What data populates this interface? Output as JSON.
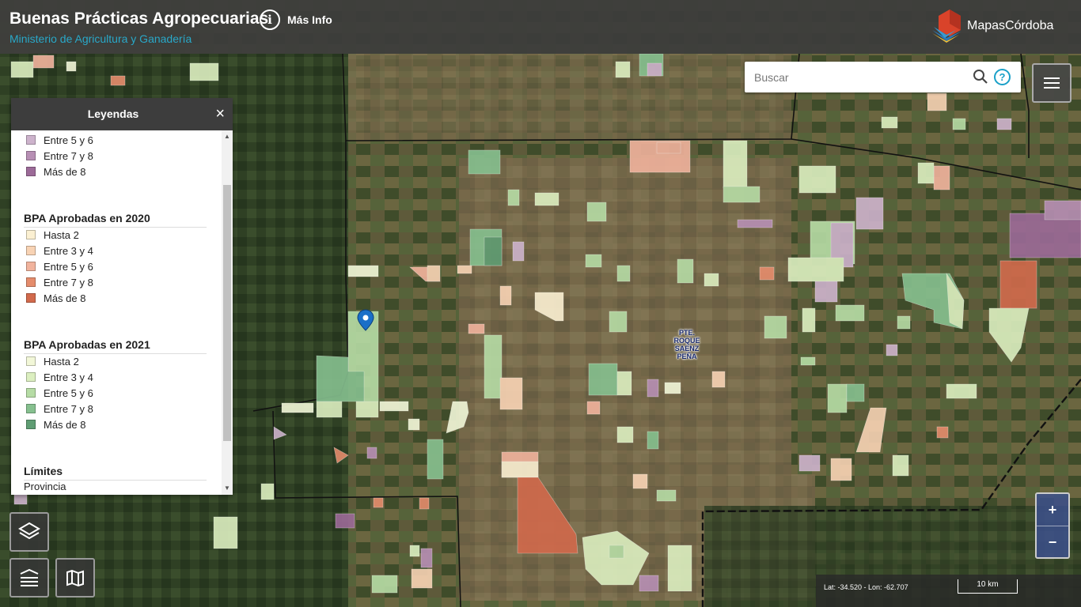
{
  "header": {
    "title": "Buenas Prácticas Agropecuarias",
    "subtitle": "Ministerio de Agricultura y Ganadería",
    "info_label": "Más Info",
    "brand_label": "MapasCórdoba"
  },
  "search": {
    "placeholder": "Buscar",
    "value": ""
  },
  "map": {
    "city_label": "PTE. ROQUE SAENZ PEÑA"
  },
  "legend": {
    "title": "Leyendas",
    "sections": [
      {
        "title": "",
        "items": [
          {
            "label": "Entre 5 y 6",
            "color": "#cdb3cc"
          },
          {
            "label": "Entre 7 y 8",
            "color": "#b78fb4"
          },
          {
            "label": "Más de 8",
            "color": "#9c6a98"
          }
        ]
      },
      {
        "title": "BPA Aprobadas en 2020",
        "items": [
          {
            "label": "Hasta 2",
            "color": "#fbf0d2"
          },
          {
            "label": "Entre 3 y 4",
            "color": "#f8d3b4"
          },
          {
            "label": "Entre 5 y 6",
            "color": "#f1b39d"
          },
          {
            "label": "Entre 7 y 8",
            "color": "#e58c6c"
          },
          {
            "label": "Más de 8",
            "color": "#d26a4c"
          }
        ]
      },
      {
        "title": "BPA Aprobadas en 2021",
        "items": [
          {
            "label": "Hasta 2",
            "color": "#f2f7d8"
          },
          {
            "label": "Entre 3 y 4",
            "color": "#dcefc0"
          },
          {
            "label": "Entre 5 y 6",
            "color": "#b6dca5"
          },
          {
            "label": "Entre 7 y 8",
            "color": "#86c08f"
          },
          {
            "label": "Más de 8",
            "color": "#5f9d73"
          }
        ]
      },
      {
        "title": "Límites",
        "items": [
          {
            "label": "Provincia",
            "color": ""
          }
        ]
      }
    ]
  },
  "zoom": {
    "in_label": "+",
    "out_label": "−"
  },
  "status": {
    "coordinates": "Lat: -34.520 - Lon: -62.707",
    "scale_label": "10 km"
  }
}
